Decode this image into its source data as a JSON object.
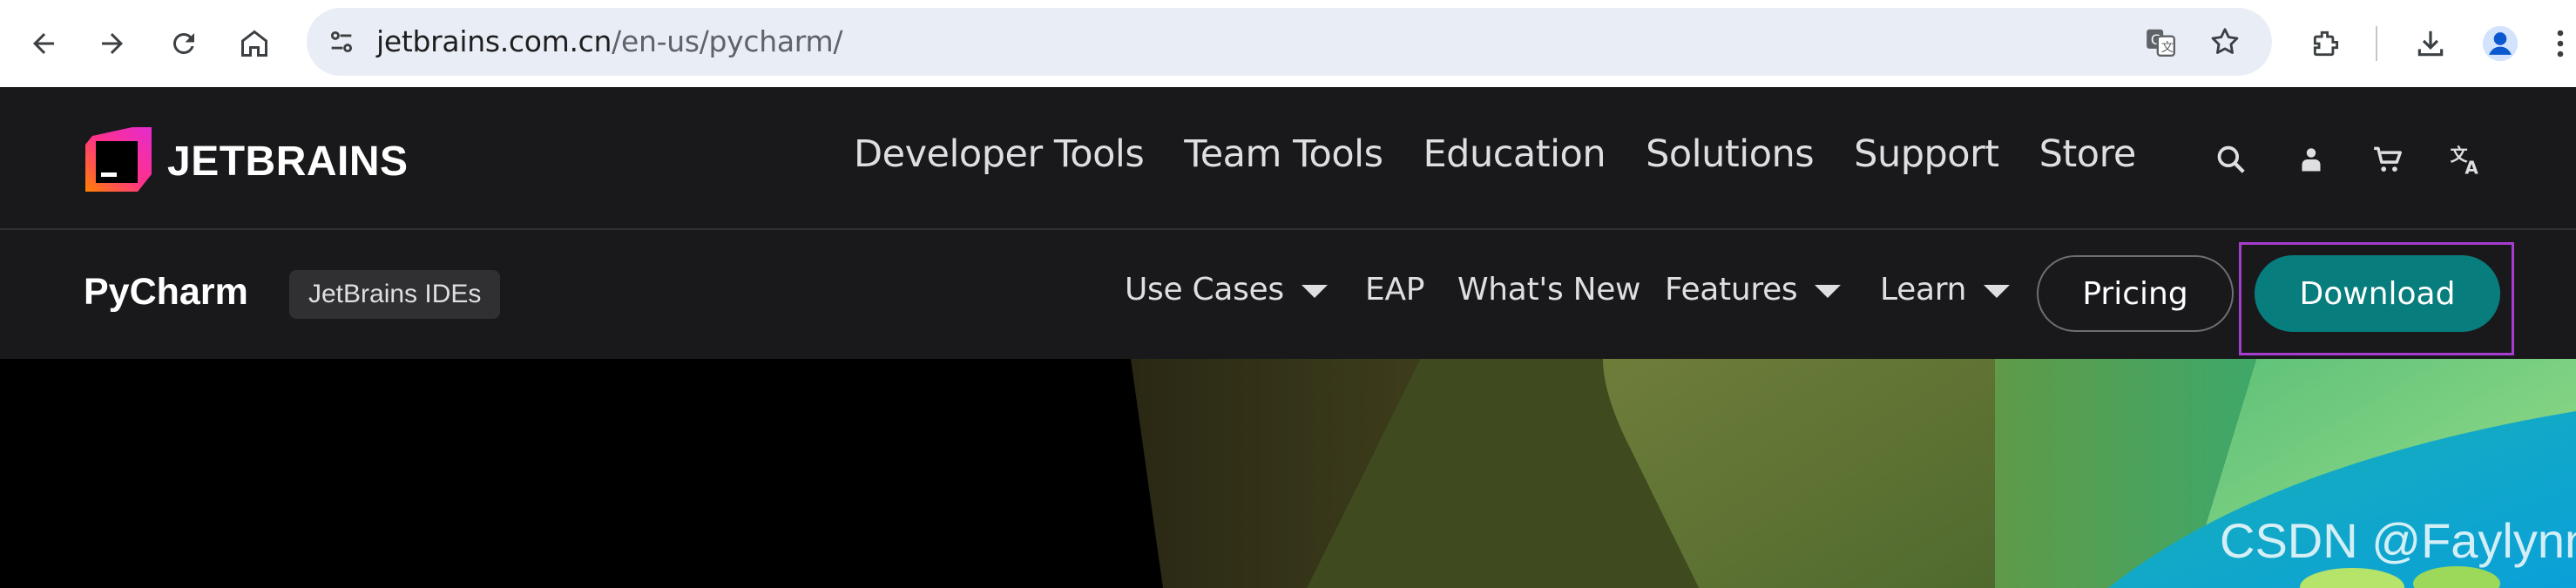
{
  "browser": {
    "url_domain": "jetbrains.com.cn",
    "url_path": "/en-us/pycharm/",
    "icons": [
      "back-arrow-icon",
      "forward-arrow-icon",
      "reload-icon",
      "home-icon",
      "site-info-icon",
      "translate-icon",
      "star-icon",
      "extensions-icon",
      "download-icon",
      "profile-icon",
      "more-icon"
    ]
  },
  "site": {
    "logo_text": "JETBRAINS",
    "top_nav": [
      "Developer Tools",
      "Team Tools",
      "Education",
      "Solutions",
      "Support",
      "Store"
    ],
    "top_icons": [
      "search-icon",
      "user-icon",
      "cart-icon",
      "language-icon"
    ]
  },
  "product_nav": {
    "product_name": "PyCharm",
    "badge": "JetBrains IDEs",
    "items": [
      {
        "label": "Use Cases",
        "dropdown": true
      },
      {
        "label": "EAP",
        "dropdown": false
      },
      {
        "label": "What's New",
        "dropdown": false
      },
      {
        "label": "Features",
        "dropdown": true
      },
      {
        "label": "Learn",
        "dropdown": true
      }
    ],
    "pricing_label": "Pricing",
    "download_label": "Download"
  },
  "colors": {
    "nav_bg": "#19191c",
    "download_bg": "#087d7d",
    "highlight_border": "#a63dcf"
  },
  "watermark": "CSDN @Faylynn"
}
